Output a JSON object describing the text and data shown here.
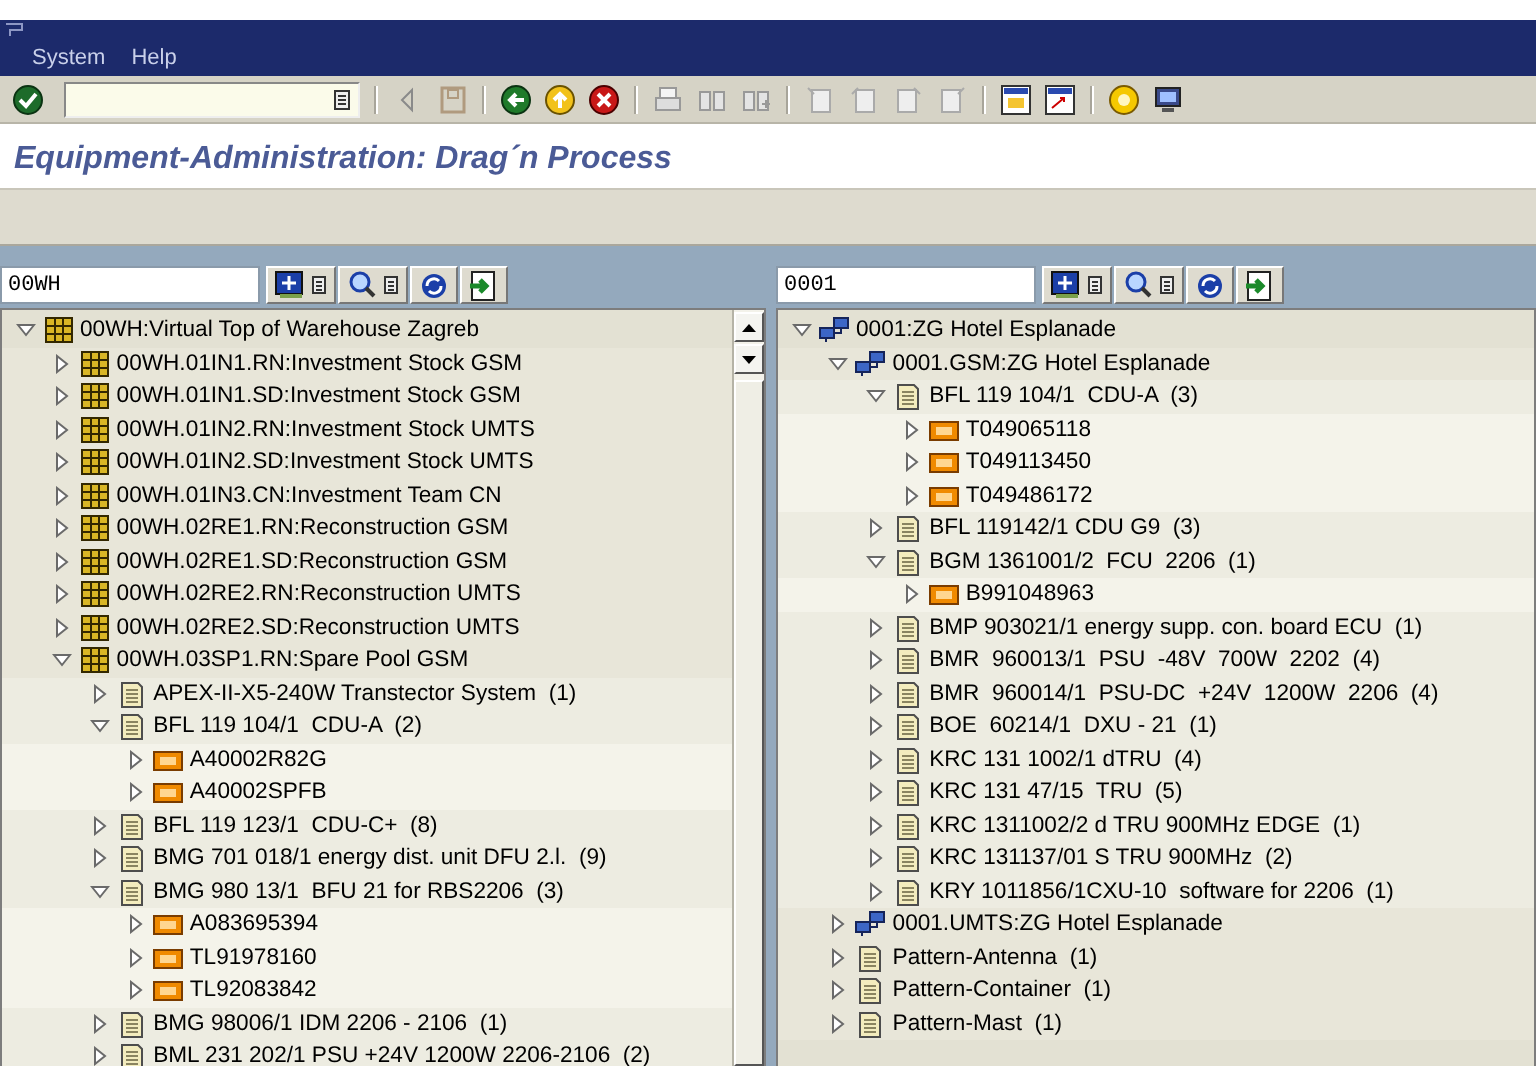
{
  "menu": [
    "System",
    "Help"
  ],
  "title": "Equipment-Administration: Drag´n Process",
  "panels": [
    {
      "kind": "scrolled",
      "search": {
        "value": "00WH"
      },
      "nodes": [
        {
          "kind": "warehouse",
          "label": "00WH:Virtual Top of Warehouse Zagreb",
          "expanded": true,
          "children": [
            {
              "kind": "warehouse",
              "label": "00WH.01IN1.RN:Investment Stock GSM",
              "expanded": false
            },
            {
              "kind": "warehouse",
              "label": "00WH.01IN1.SD:Investment Stock GSM",
              "expanded": false
            },
            {
              "kind": "warehouse",
              "label": "00WH.01IN2.RN:Investment Stock UMTS",
              "expanded": false
            },
            {
              "kind": "warehouse",
              "label": "00WH.01IN2.SD:Investment Stock UMTS",
              "expanded": false
            },
            {
              "kind": "warehouse",
              "label": "00WH.01IN3.CN:Investment Team CN",
              "expanded": false
            },
            {
              "kind": "warehouse",
              "label": "00WH.02RE1.RN:Reconstruction GSM",
              "expanded": false
            },
            {
              "kind": "warehouse",
              "label": "00WH.02RE1.SD:Reconstruction GSM",
              "expanded": false
            },
            {
              "kind": "warehouse",
              "label": "00WH.02RE2.RN:Reconstruction UMTS",
              "expanded": false
            },
            {
              "kind": "warehouse",
              "label": "00WH.02RE2.SD:Reconstruction UMTS",
              "expanded": false
            },
            {
              "kind": "warehouse",
              "label": "00WH.03SP1.RN:Spare Pool GSM",
              "expanded": true,
              "children": [
                {
                  "kind": "document",
                  "label": "APEX-II-X5-240W Transtector System  (1)",
                  "expanded": false
                },
                {
                  "kind": "document",
                  "label": "BFL 119 104/1  CDU-A  (2)",
                  "expanded": true,
                  "children": [
                    {
                      "kind": "item",
                      "label": "A40002R82G",
                      "expanded": false
                    },
                    {
                      "kind": "item",
                      "label": "A40002SPFB",
                      "expanded": false
                    }
                  ]
                },
                {
                  "kind": "document",
                  "label": "BFL 119 123/1  CDU-C+  (8)",
                  "expanded": false
                },
                {
                  "kind": "document",
                  "label": "BMG 701 018/1 energy dist. unit DFU 2.l.  (9)",
                  "expanded": false
                },
                {
                  "kind": "document",
                  "label": "BMG 980 13/1  BFU 21 for RBS2206  (3)",
                  "expanded": true,
                  "children": [
                    {
                      "kind": "item",
                      "label": "A083695394",
                      "expanded": false
                    },
                    {
                      "kind": "item",
                      "label": "TL91978160",
                      "expanded": false
                    },
                    {
                      "kind": "item",
                      "label": "TL92083842",
                      "expanded": false
                    }
                  ]
                },
                {
                  "kind": "document",
                  "label": "BMG 98006/1 IDM 2206 - 2106  (1)",
                  "expanded": false
                },
                {
                  "kind": "document",
                  "label": "BML 231 202/1 PSU +24V 1200W 2206-2106  (2)",
                  "expanded": false
                }
              ]
            }
          ]
        }
      ]
    },
    {
      "kind": "plain",
      "search": {
        "value": "0001"
      },
      "nodes": [
        {
          "kind": "site",
          "label": "0001:ZG Hotel Esplanade",
          "expanded": true,
          "children": [
            {
              "kind": "site",
              "label": "0001.GSM:ZG Hotel Esplanade",
              "expanded": true,
              "children": [
                {
                  "kind": "document",
                  "label": "BFL 119 104/1  CDU-A  (3)",
                  "expanded": true,
                  "children": [
                    {
                      "kind": "item",
                      "label": "T049065118",
                      "expanded": false
                    },
                    {
                      "kind": "item",
                      "label": "T049113450",
                      "expanded": false
                    },
                    {
                      "kind": "item",
                      "label": "T049486172",
                      "expanded": false
                    }
                  ]
                },
                {
                  "kind": "document",
                  "label": "BFL 119142/1 CDU G9  (3)",
                  "expanded": false
                },
                {
                  "kind": "document",
                  "label": "BGM 1361001/2  FCU  2206  (1)",
                  "expanded": true,
                  "children": [
                    {
                      "kind": "item",
                      "label": "B991048963",
                      "expanded": false
                    }
                  ]
                },
                {
                  "kind": "document",
                  "label": "BMP 903021/1 energy supp. con. board ECU  (1)",
                  "expanded": false
                },
                {
                  "kind": "document",
                  "label": "BMR  960013/1  PSU  -48V  700W  2202  (4)",
                  "expanded": false
                },
                {
                  "kind": "document",
                  "label": "BMR  960014/1  PSU-DC  +24V  1200W  2206  (4)",
                  "expanded": false
                },
                {
                  "kind": "document",
                  "label": "BOE  60214/1  DXU - 21  (1)",
                  "expanded": false
                },
                {
                  "kind": "document",
                  "label": "KRC 131 1002/1 dTRU  (4)",
                  "expanded": false
                },
                {
                  "kind": "document",
                  "label": "KRC 131 47/15  TRU  (5)",
                  "expanded": false
                },
                {
                  "kind": "document",
                  "label": "KRC 1311002/2 d TRU 900MHz EDGE  (1)",
                  "expanded": false
                },
                {
                  "kind": "document",
                  "label": "KRC 131137/01 S TRU 900MHz  (2)",
                  "expanded": false
                },
                {
                  "kind": "document",
                  "label": "KRY 1011856/1CXU-10  software for 2206  (1)",
                  "expanded": false
                }
              ]
            },
            {
              "kind": "site",
              "label": "0001.UMTS:ZG Hotel Esplanade",
              "expanded": false
            },
            {
              "kind": "document",
              "label": "Pattern-Antenna  (1)",
              "expanded": false
            },
            {
              "kind": "document",
              "label": "Pattern-Container  (1)",
              "expanded": false
            },
            {
              "kind": "document",
              "label": "Pattern-Mast  (1)",
              "expanded": false
            }
          ]
        }
      ]
    }
  ]
}
